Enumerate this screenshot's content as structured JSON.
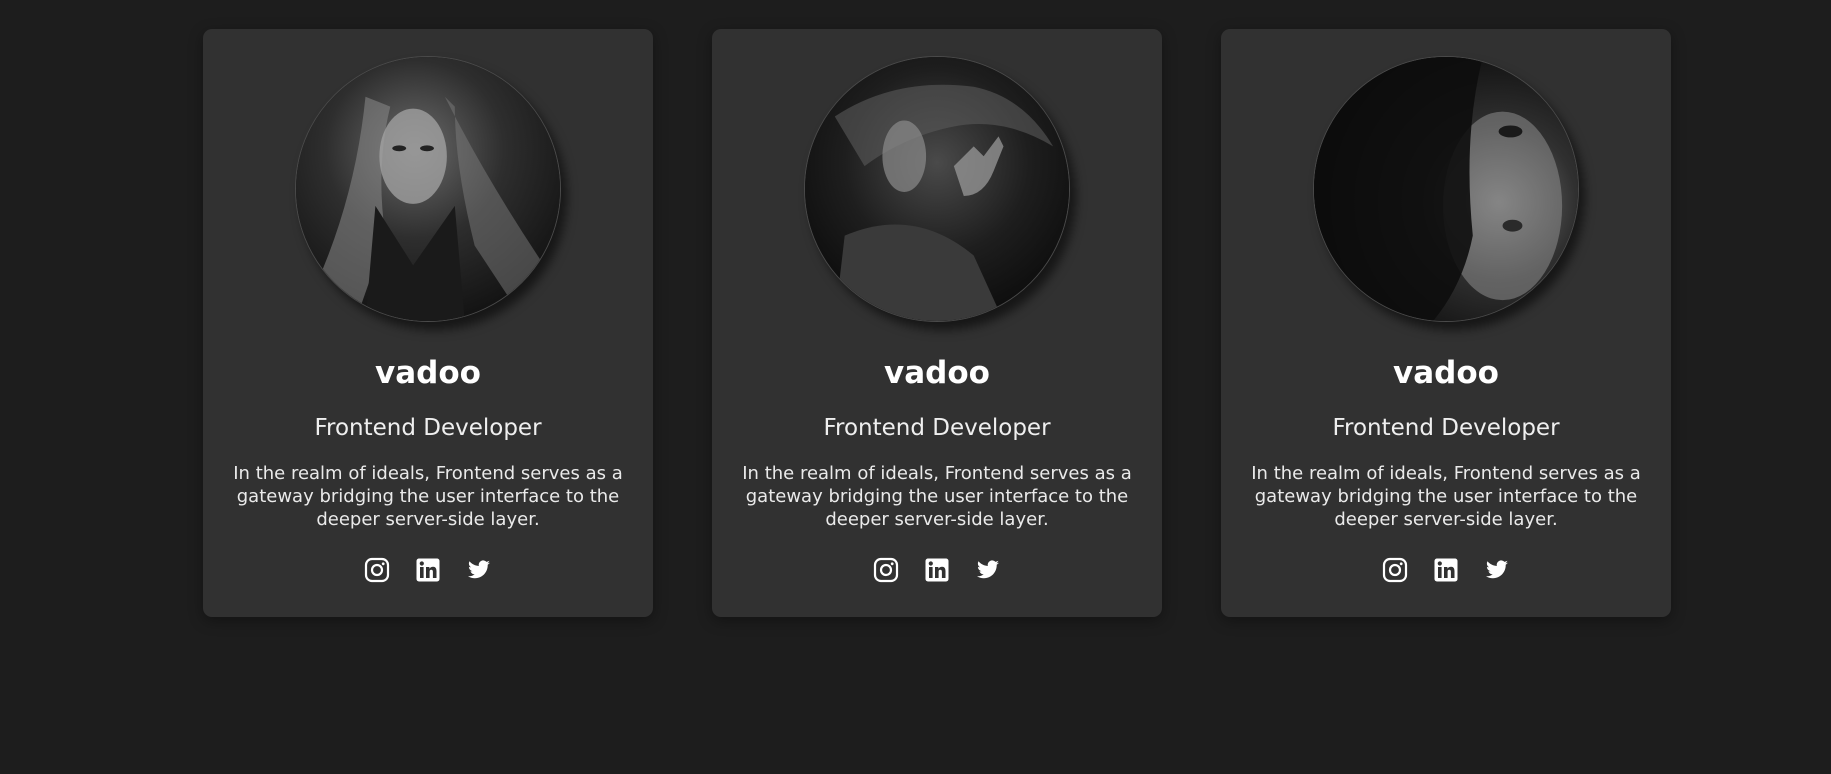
{
  "cards": [
    {
      "avatar": "portrait-photo-1",
      "name": "vadoo",
      "role": "Frontend Developer",
      "bio": "In the realm of ideals, Frontend serves as a gateway bridging the user interface to the deeper server-side layer.",
      "socials": [
        "instagram-icon",
        "linkedin-icon",
        "twitter-icon"
      ]
    },
    {
      "avatar": "portrait-photo-2",
      "name": "vadoo",
      "role": "Frontend Developer",
      "bio": "In the realm of ideals, Frontend serves as a gateway bridging the user interface to the deeper server-side layer.",
      "socials": [
        "instagram-icon",
        "linkedin-icon",
        "twitter-icon"
      ]
    },
    {
      "avatar": "portrait-photo-3",
      "name": "vadoo",
      "role": "Frontend Developer",
      "bio": "In the realm of ideals, Frontend serves as a gateway bridging the user interface to the deeper server-side layer.",
      "socials": [
        "instagram-icon",
        "linkedin-icon",
        "twitter-icon"
      ]
    }
  ],
  "colors": {
    "page_background": "#1d1d1d",
    "card_background": "#313131",
    "text": "#ffffff"
  }
}
